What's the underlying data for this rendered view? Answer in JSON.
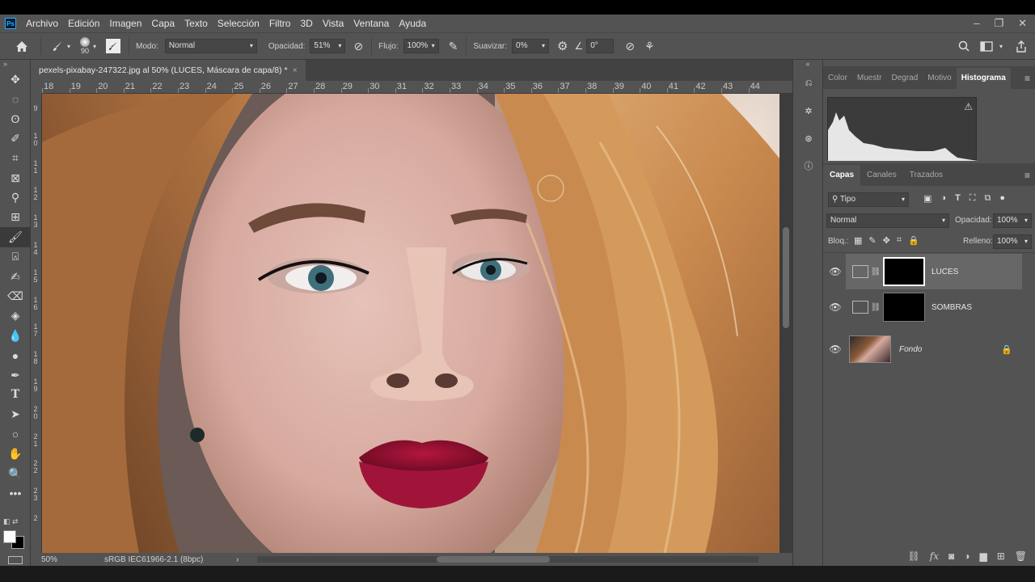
{
  "menubar": {
    "app_logo": "Ps",
    "items": [
      "Archivo",
      "Edición",
      "Imagen",
      "Capa",
      "Texto",
      "Selección",
      "Filtro",
      "3D",
      "Vista",
      "Ventana",
      "Ayuda"
    ],
    "window_controls": [
      "minimize-icon",
      "restore-icon",
      "close-icon"
    ]
  },
  "options": {
    "brush_size": "90",
    "mode_label": "Modo:",
    "mode_value": "Normal",
    "opacity_label": "Opacidad:",
    "opacity_value": "51%",
    "flow_label": "Flujo:",
    "flow_value": "100%",
    "smooth_label": "Suavizar:",
    "smooth_value": "0%",
    "angle_value": "0°"
  },
  "document": {
    "tab_title": "pexels-pixabay-247322.jpg al 50% (LUCES, Máscara de capa/8) *",
    "close": "×",
    "zoom": "50%",
    "color_profile": "sRGB IEC61966-2.1 (8bpc)",
    "ruler_h_labels": [
      "18",
      "19",
      "20",
      "21",
      "22",
      "23",
      "24",
      "25",
      "26",
      "27",
      "28",
      "29",
      "30",
      "31",
      "32",
      "33",
      "34",
      "35",
      "36",
      "37",
      "38",
      "39",
      "40",
      "41",
      "42",
      "43",
      "44"
    ],
    "ruler_v_labels": [
      "9",
      "10",
      "11",
      "12",
      "13",
      "14",
      "15",
      "16",
      "17",
      "18",
      "19",
      "20",
      "21",
      "22",
      "23",
      "2"
    ]
  },
  "top_panel": {
    "tabs": [
      "Color",
      "Muestr",
      "Degrad",
      "Motivo",
      "Histograma"
    ],
    "active_tab": "Histograma"
  },
  "layers_panel": {
    "tabs": [
      "Capas",
      "Canales",
      "Trazados"
    ],
    "active_tab": "Capas",
    "filter_label": "Tipo",
    "blend_mode": "Normal",
    "opacity_label": "Opacidad:",
    "opacity_value": "100%",
    "lock_label": "Bloq.:",
    "fill_label": "Relleno:",
    "fill_value": "100%",
    "layers": [
      {
        "name": "LUCES",
        "type": "curves-adjustment",
        "selected": true
      },
      {
        "name": "SOMBRAS",
        "type": "curves-adjustment",
        "selected": false
      },
      {
        "name": "Fondo",
        "type": "image",
        "selected": false,
        "locked": true
      }
    ]
  },
  "colors": {
    "ui_bg": "#535353",
    "ui_dark": "#3a3a3a",
    "selected_layer": "#676767",
    "lip_color": "#8a0f2e"
  }
}
